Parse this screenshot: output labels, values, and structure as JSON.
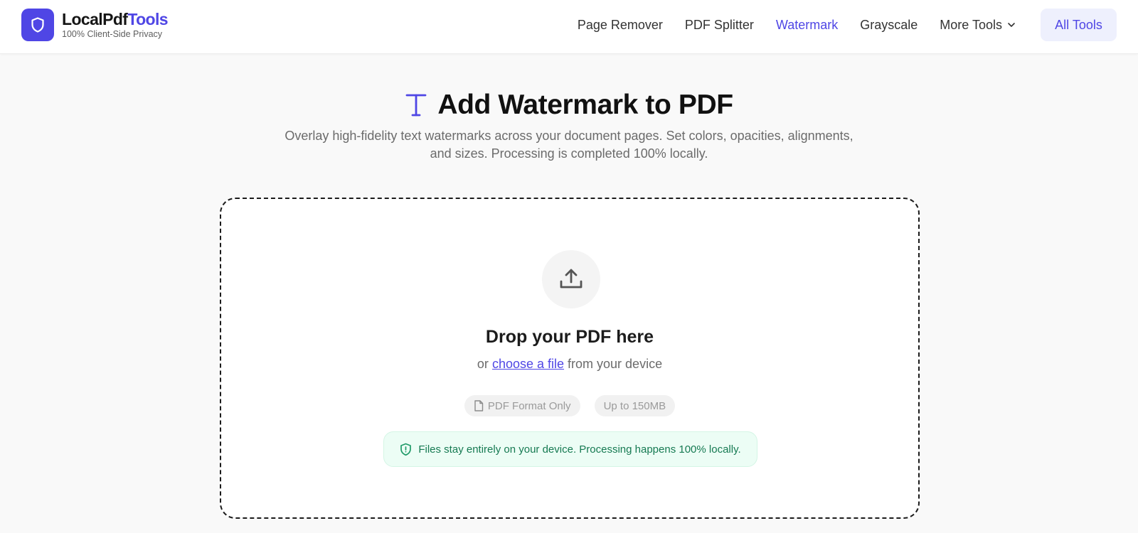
{
  "brand": {
    "name_main": "LocalPdf",
    "name_accent": "Tools",
    "tagline": "100% Client-Side Privacy",
    "logo_icon": "shield-icon"
  },
  "nav": {
    "items": [
      {
        "label": "Page Remover",
        "active": false
      },
      {
        "label": "PDF Splitter",
        "active": false
      },
      {
        "label": "Watermark",
        "active": true
      },
      {
        "label": "Grayscale",
        "active": false
      }
    ],
    "more_label": "More Tools",
    "more_icon": "chevron-down-icon",
    "all_tools_label": "All Tools"
  },
  "hero": {
    "icon": "text-type-icon",
    "title": "Add Watermark to PDF",
    "subtitle": "Overlay high-fidelity text watermarks across your document pages. Set colors, opacities, alignments, and sizes. Processing is completed 100% locally."
  },
  "dropzone": {
    "upload_icon": "upload-icon",
    "title": "Drop your PDF here",
    "sub_prefix": "or",
    "sub_link": "choose a file",
    "sub_suffix": "from your device",
    "chips": [
      {
        "label": "PDF Format Only",
        "icon": "file-icon"
      },
      {
        "label": "Up to 150MB",
        "icon": ""
      }
    ],
    "privacy_note": "Files stay entirely on your device. Processing happens 100% locally.",
    "privacy_icon": "shield-alert-icon"
  },
  "colors": {
    "accent": "#4f46e5",
    "accent_soft": "#eef0fd",
    "success_text": "#167a52",
    "success_bg": "#ecfdf5",
    "page_bg": "#f9f9f9"
  }
}
